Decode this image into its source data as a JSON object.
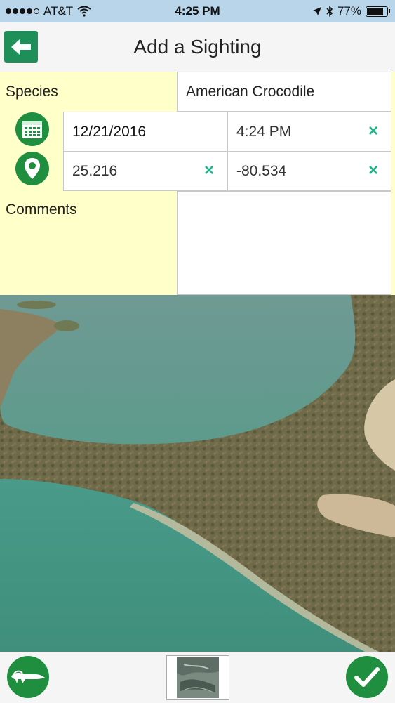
{
  "status_bar": {
    "carrier": "AT&T",
    "time": "4:25 PM",
    "battery": "77%",
    "battery_fraction": 0.77
  },
  "header": {
    "title": "Add a Sighting",
    "back_icon": "arrow-left-icon"
  },
  "form": {
    "species_label": "Species",
    "species_value": "American Crocodile",
    "date_value": "12/21/2016",
    "time_value": "4:24 PM",
    "latitude_value": "25.216",
    "longitude_value": "-80.534",
    "comments_label": "Comments",
    "comments_value": "",
    "clear_glyph": "×"
  },
  "toolbar": {
    "left_icon": "crocodile-icon",
    "right_icon": "checkmark-icon"
  },
  "colors": {
    "accent_green": "#1f8f3f",
    "form_background": "#ffffc9",
    "clear_x": "#1fb58a",
    "status_bar": "#b9d5ea"
  }
}
